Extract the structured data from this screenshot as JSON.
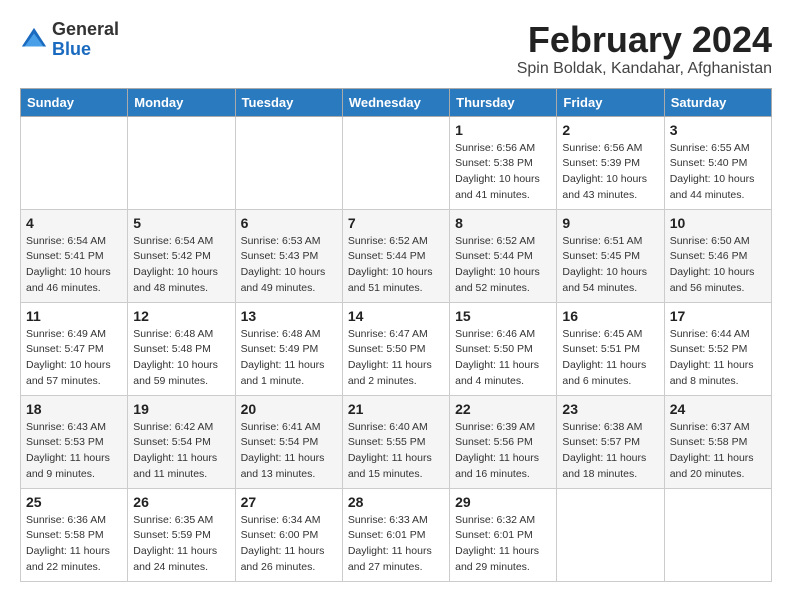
{
  "header": {
    "logo_general": "General",
    "logo_blue": "Blue",
    "month": "February 2024",
    "location": "Spin Boldak, Kandahar, Afghanistan"
  },
  "days_of_week": [
    "Sunday",
    "Monday",
    "Tuesday",
    "Wednesday",
    "Thursday",
    "Friday",
    "Saturday"
  ],
  "weeks": [
    [
      {
        "day": "",
        "detail": ""
      },
      {
        "day": "",
        "detail": ""
      },
      {
        "day": "",
        "detail": ""
      },
      {
        "day": "",
        "detail": ""
      },
      {
        "day": "1",
        "detail": "Sunrise: 6:56 AM\nSunset: 5:38 PM\nDaylight: 10 hours\nand 41 minutes."
      },
      {
        "day": "2",
        "detail": "Sunrise: 6:56 AM\nSunset: 5:39 PM\nDaylight: 10 hours\nand 43 minutes."
      },
      {
        "day": "3",
        "detail": "Sunrise: 6:55 AM\nSunset: 5:40 PM\nDaylight: 10 hours\nand 44 minutes."
      }
    ],
    [
      {
        "day": "4",
        "detail": "Sunrise: 6:54 AM\nSunset: 5:41 PM\nDaylight: 10 hours\nand 46 minutes."
      },
      {
        "day": "5",
        "detail": "Sunrise: 6:54 AM\nSunset: 5:42 PM\nDaylight: 10 hours\nand 48 minutes."
      },
      {
        "day": "6",
        "detail": "Sunrise: 6:53 AM\nSunset: 5:43 PM\nDaylight: 10 hours\nand 49 minutes."
      },
      {
        "day": "7",
        "detail": "Sunrise: 6:52 AM\nSunset: 5:44 PM\nDaylight: 10 hours\nand 51 minutes."
      },
      {
        "day": "8",
        "detail": "Sunrise: 6:52 AM\nSunset: 5:44 PM\nDaylight: 10 hours\nand 52 minutes."
      },
      {
        "day": "9",
        "detail": "Sunrise: 6:51 AM\nSunset: 5:45 PM\nDaylight: 10 hours\nand 54 minutes."
      },
      {
        "day": "10",
        "detail": "Sunrise: 6:50 AM\nSunset: 5:46 PM\nDaylight: 10 hours\nand 56 minutes."
      }
    ],
    [
      {
        "day": "11",
        "detail": "Sunrise: 6:49 AM\nSunset: 5:47 PM\nDaylight: 10 hours\nand 57 minutes."
      },
      {
        "day": "12",
        "detail": "Sunrise: 6:48 AM\nSunset: 5:48 PM\nDaylight: 10 hours\nand 59 minutes."
      },
      {
        "day": "13",
        "detail": "Sunrise: 6:48 AM\nSunset: 5:49 PM\nDaylight: 11 hours\nand 1 minute."
      },
      {
        "day": "14",
        "detail": "Sunrise: 6:47 AM\nSunset: 5:50 PM\nDaylight: 11 hours\nand 2 minutes."
      },
      {
        "day": "15",
        "detail": "Sunrise: 6:46 AM\nSunset: 5:50 PM\nDaylight: 11 hours\nand 4 minutes."
      },
      {
        "day": "16",
        "detail": "Sunrise: 6:45 AM\nSunset: 5:51 PM\nDaylight: 11 hours\nand 6 minutes."
      },
      {
        "day": "17",
        "detail": "Sunrise: 6:44 AM\nSunset: 5:52 PM\nDaylight: 11 hours\nand 8 minutes."
      }
    ],
    [
      {
        "day": "18",
        "detail": "Sunrise: 6:43 AM\nSunset: 5:53 PM\nDaylight: 11 hours\nand 9 minutes."
      },
      {
        "day": "19",
        "detail": "Sunrise: 6:42 AM\nSunset: 5:54 PM\nDaylight: 11 hours\nand 11 minutes."
      },
      {
        "day": "20",
        "detail": "Sunrise: 6:41 AM\nSunset: 5:54 PM\nDaylight: 11 hours\nand 13 minutes."
      },
      {
        "day": "21",
        "detail": "Sunrise: 6:40 AM\nSunset: 5:55 PM\nDaylight: 11 hours\nand 15 minutes."
      },
      {
        "day": "22",
        "detail": "Sunrise: 6:39 AM\nSunset: 5:56 PM\nDaylight: 11 hours\nand 16 minutes."
      },
      {
        "day": "23",
        "detail": "Sunrise: 6:38 AM\nSunset: 5:57 PM\nDaylight: 11 hours\nand 18 minutes."
      },
      {
        "day": "24",
        "detail": "Sunrise: 6:37 AM\nSunset: 5:58 PM\nDaylight: 11 hours\nand 20 minutes."
      }
    ],
    [
      {
        "day": "25",
        "detail": "Sunrise: 6:36 AM\nSunset: 5:58 PM\nDaylight: 11 hours\nand 22 minutes."
      },
      {
        "day": "26",
        "detail": "Sunrise: 6:35 AM\nSunset: 5:59 PM\nDaylight: 11 hours\nand 24 minutes."
      },
      {
        "day": "27",
        "detail": "Sunrise: 6:34 AM\nSunset: 6:00 PM\nDaylight: 11 hours\nand 26 minutes."
      },
      {
        "day": "28",
        "detail": "Sunrise: 6:33 AM\nSunset: 6:01 PM\nDaylight: 11 hours\nand 27 minutes."
      },
      {
        "day": "29",
        "detail": "Sunrise: 6:32 AM\nSunset: 6:01 PM\nDaylight: 11 hours\nand 29 minutes."
      },
      {
        "day": "",
        "detail": ""
      },
      {
        "day": "",
        "detail": ""
      }
    ]
  ]
}
